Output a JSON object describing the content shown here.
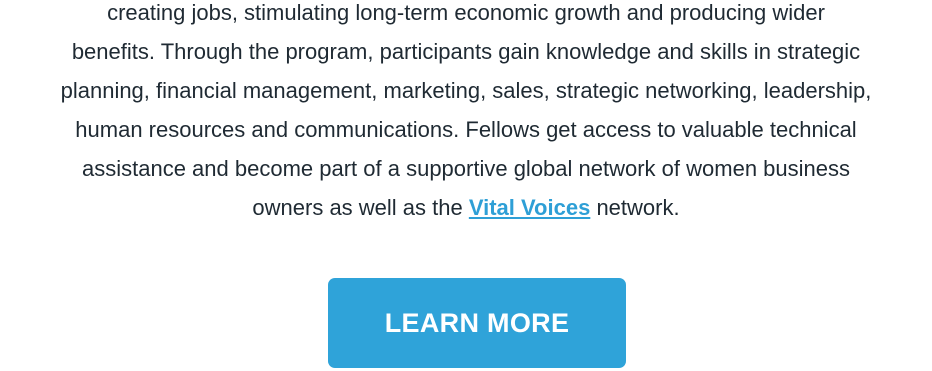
{
  "body_text": {
    "lines": [
      "creating jobs, stimulating long-term economic growth and producing wider",
      "benefits. Through the program, participants gain knowledge and skills in strategic",
      "planning, financial management, marketing, sales, strategic networking, leadership,",
      "human resources and communications. Fellows get access to valuable technical",
      "assistance and become part of a supportive global network of women business"
    ],
    "last_line_before": "owners as well as the ",
    "link_text": "Vital Voices",
    "last_line_after": " network."
  },
  "cta": {
    "label": "LEARN MORE"
  },
  "colors": {
    "text": "#1f2a33",
    "link": "#2e9fd6",
    "button_bg": "#2fa3d9",
    "button_text": "#ffffff"
  }
}
